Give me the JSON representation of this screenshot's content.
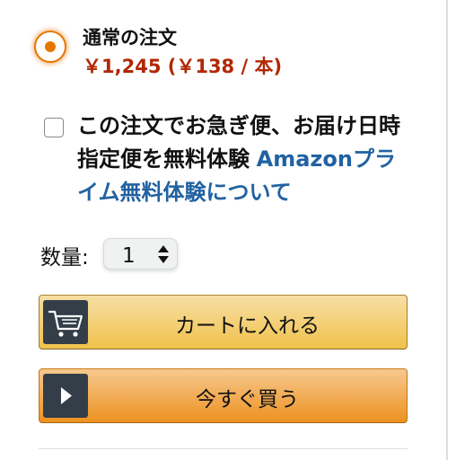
{
  "delivery_option": {
    "title": "通常の注文",
    "price": "￥1,245 (￥138 / 本)",
    "selected": true
  },
  "express": {
    "checked": false,
    "text": "この注文でお急ぎ便、お届け日時指定便を無料体験",
    "link": "Amazonプライム無料体験について"
  },
  "quantity": {
    "label": "数量:",
    "value": "1"
  },
  "buttons": {
    "add_to_cart": "カートに入れる",
    "buy_now": "今すぐ買う"
  },
  "colors": {
    "price": "#b12704",
    "link": "#2162a1",
    "radio_accent": "#e77600",
    "cart_button": "#f0c14b",
    "buy_button": "#ed9220",
    "icon_background": "#333e48"
  },
  "icons": {
    "cart": "shopping-cart-icon",
    "buy": "play-icon",
    "quantity": "updown-arrows-icon"
  }
}
